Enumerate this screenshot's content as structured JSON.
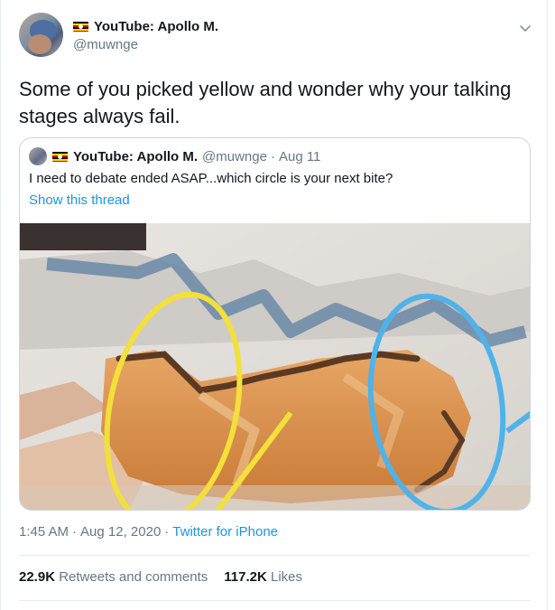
{
  "tweet": {
    "author": {
      "display_name": "YouTube: Apollo M.",
      "handle": "@muwnge"
    },
    "text": "Some of you picked yellow and wonder why your talking stages always fail.",
    "time": "1:45 AM",
    "date": "Aug 12, 2020",
    "separator": "·",
    "source": "Twitter for iPhone",
    "retweets_count": "22.9K",
    "retweets_label": "Retweets and comments",
    "likes_count": "117.2K",
    "likes_label": "Likes"
  },
  "quoted_tweet": {
    "display_name": "YouTube: Apollo M.",
    "handle": "@muwnge",
    "date": "Aug 11",
    "text": "I need to debate ended ASAP...which circle is your next bite?",
    "show_thread": "Show this thread"
  },
  "icons": {
    "menu": "chevron-down-icon",
    "flag": "uganda-flag-icon"
  },
  "colors": {
    "link": "#1b95e0",
    "secondary": "#657786",
    "yellow_circle": "#f3e03a",
    "blue_circle": "#4fb3ea"
  }
}
